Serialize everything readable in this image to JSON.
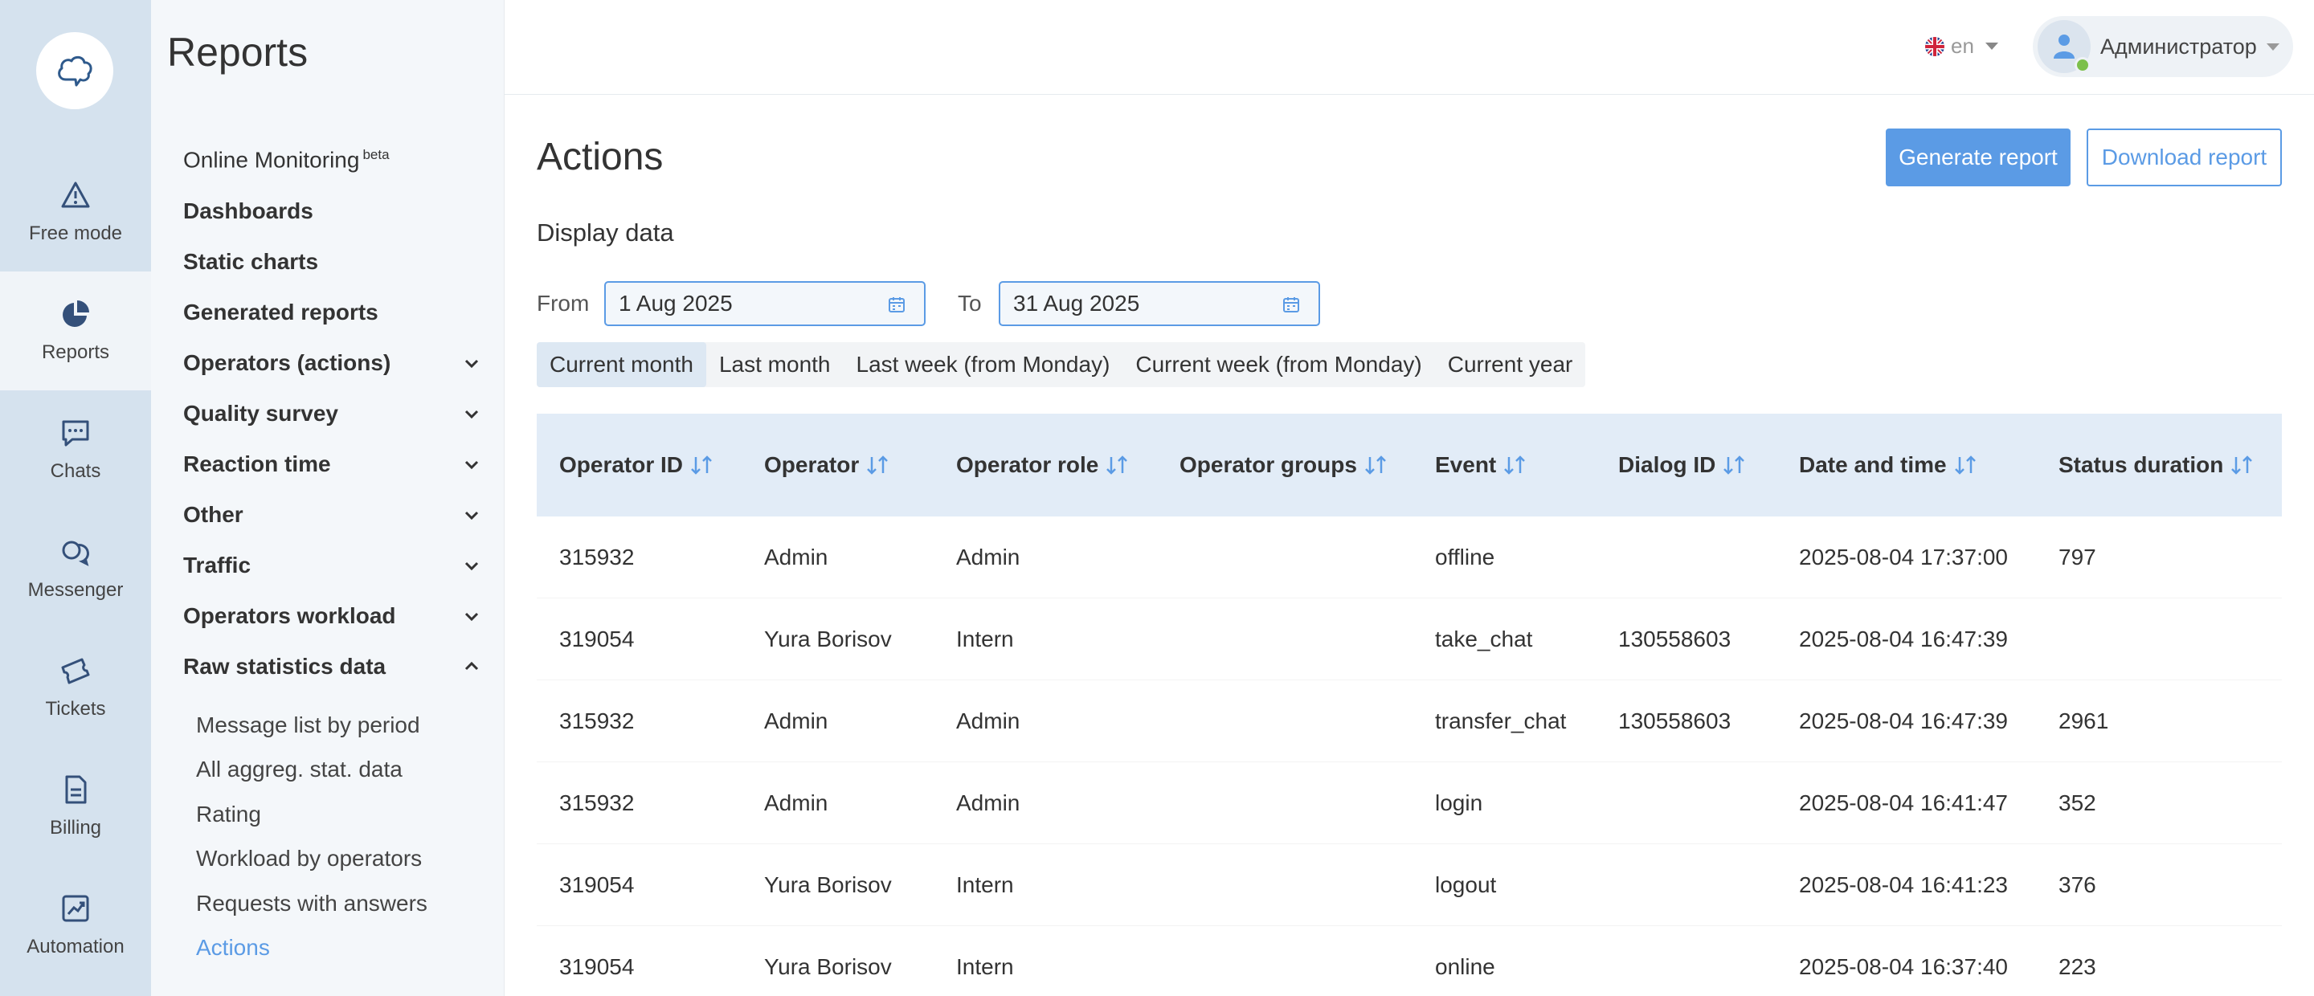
{
  "rail": {
    "items": [
      {
        "label": "Free mode",
        "icon": "warning-triangle-icon"
      },
      {
        "label": "Reports",
        "icon": "pie-chart-icon"
      },
      {
        "label": "Chats",
        "icon": "chat-bubble-icon"
      },
      {
        "label": "Messenger",
        "icon": "messenger-icon"
      },
      {
        "label": "Tickets",
        "icon": "ticket-icon"
      },
      {
        "label": "Billing",
        "icon": "document-icon"
      },
      {
        "label": "Automation",
        "icon": "trend-chart-icon"
      }
    ]
  },
  "sidebar": {
    "title": "Reports",
    "online_monitoring": "Online Monitoring",
    "beta": "beta",
    "items": [
      {
        "label": "Dashboards"
      },
      {
        "label": "Static charts"
      },
      {
        "label": "Generated reports"
      },
      {
        "label": "Operators (actions)"
      },
      {
        "label": "Quality survey"
      },
      {
        "label": "Reaction time"
      },
      {
        "label": "Other"
      },
      {
        "label": "Traffic"
      },
      {
        "label": "Operators workload"
      },
      {
        "label": "Raw statistics data"
      }
    ],
    "sub_items": [
      {
        "label": "Message list by period"
      },
      {
        "label": "All aggreg. stat. data"
      },
      {
        "label": "Rating"
      },
      {
        "label": "Workload by operators"
      },
      {
        "label": "Requests with answers"
      },
      {
        "label": "Actions"
      }
    ]
  },
  "header": {
    "lang": "en",
    "user_name": "Администратор"
  },
  "main": {
    "title": "Actions",
    "generate_label": "Generate report",
    "download_label": "Download report",
    "section_title": "Display data",
    "from_label": "From",
    "from_value": "1 Aug 2025",
    "to_label": "To",
    "to_value": "31 Aug 2025",
    "presets": [
      {
        "label": "Current month"
      },
      {
        "label": "Last month"
      },
      {
        "label": "Last week (from Monday)"
      },
      {
        "label": "Current week (from Monday)"
      },
      {
        "label": "Current year"
      }
    ]
  },
  "table": {
    "columns": [
      {
        "label": "Operator ID"
      },
      {
        "label": "Operator"
      },
      {
        "label": "Operator role"
      },
      {
        "label": "Operator groups"
      },
      {
        "label": "Event"
      },
      {
        "label": "Dialog ID"
      },
      {
        "label": "Date and time"
      },
      {
        "label": "Status duration"
      }
    ],
    "rows": [
      [
        "315932",
        "Admin",
        "Admin",
        "",
        "offline",
        "",
        "2025-08-04 17:37:00",
        "797"
      ],
      [
        "319054",
        "Yura Borisov",
        "Intern",
        "",
        "take_chat",
        "130558603",
        "2025-08-04 16:47:39",
        ""
      ],
      [
        "315932",
        "Admin",
        "Admin",
        "",
        "transfer_chat",
        "130558603",
        "2025-08-04 16:47:39",
        "2961"
      ],
      [
        "315932",
        "Admin",
        "Admin",
        "",
        "login",
        "",
        "2025-08-04 16:41:47",
        "352"
      ],
      [
        "319054",
        "Yura Borisov",
        "Intern",
        "",
        "logout",
        "",
        "2025-08-04 16:41:23",
        "376"
      ],
      [
        "319054",
        "Yura Borisov",
        "Intern",
        "",
        "online",
        "",
        "2025-08-04 16:37:40",
        "223"
      ]
    ]
  },
  "colors": {
    "accent": "#5b9be5",
    "rail_bg": "#d5e2ee",
    "online": "#7cc04b"
  }
}
